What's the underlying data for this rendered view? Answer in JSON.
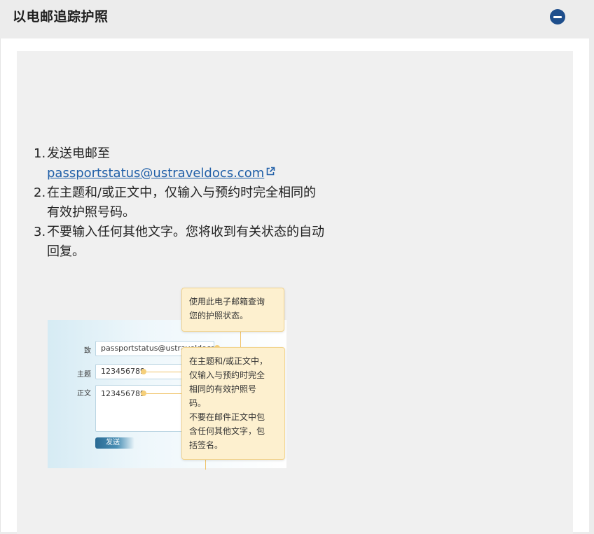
{
  "header": {
    "title": "以电邮追踪护照",
    "collapse_icon": "minus-circle-icon"
  },
  "steps": [
    {
      "num": "1.",
      "text": "发送电邮至 ",
      "link": "passportstatus@ustraveldocs.com"
    },
    {
      "num": "2.",
      "text": "在主题和/或正文中，仅输入与预约时完全相同的有效护照号码。"
    },
    {
      "num": "3.",
      "text": "不要输入任何其他文字。您将收到有关状态的自动回复。"
    }
  ],
  "illustration": {
    "to_label": "致",
    "to_value": "passportstatus@ustraveldocs.com",
    "subject_label": "主题",
    "subject_value": "123456789",
    "body_label": "正文",
    "body_value": "123456789",
    "send_label": "发送",
    "tip1": [
      "使用此电子邮箱查询",
      "您的护照状态。"
    ],
    "tip2": [
      "在主题和/或正文中，",
      "仅输入与预约时完全",
      "相同的有效护照号",
      "码。",
      "不要在邮件正文中包",
      "含任何其他文字，包",
      "括签名。"
    ]
  },
  "colors": {
    "accent": "#1e4e8c",
    "link": "#2160a8",
    "tip_bg": "#fdf0cf"
  }
}
